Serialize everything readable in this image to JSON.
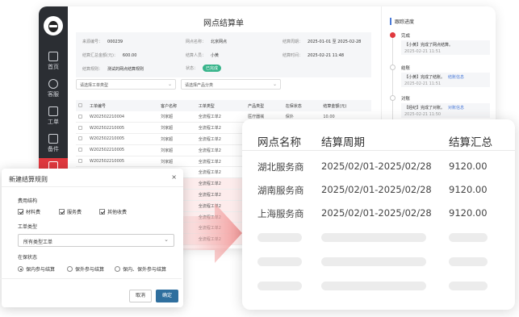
{
  "sidebar": {
    "items": [
      {
        "label": "首页"
      },
      {
        "label": "客服"
      },
      {
        "label": "工单"
      },
      {
        "label": "备件"
      },
      {
        "label": ""
      }
    ]
  },
  "page": {
    "title": "网点结算单",
    "info": {
      "order_no_label": "来源编号：",
      "order_no": "000239",
      "branch_label": "网点名称：",
      "branch": "北京网点",
      "period_label": "结算周期：",
      "period": "2025-01-01 至 2025-02-28",
      "amount_label": "结算汇总金额(元)：",
      "amount": "600.00",
      "creator_label": "结算人员：",
      "creator": "小黄",
      "time_label": "结算时间：",
      "time": "2025-02-21 11:48",
      "rule_label": "结算规则：",
      "rule": "测试的网点结算规则",
      "status_label": "状态：",
      "status": "已完成"
    },
    "filters": {
      "order_type_placeholder": "请选择工单类型",
      "product_placeholder": "请选择产品分类"
    },
    "table": {
      "headers": [
        "",
        "工单编号",
        "客户名称",
        "工单类型",
        "产品类型",
        "在保状态",
        "结算金额(元)"
      ],
      "rows": [
        [
          "W202502210004",
          "刘家超",
          "全流程工单2",
          "医疗器械",
          "保外",
          "10.00"
        ],
        [
          "W202502210005",
          "刘家超",
          "全流程工单2",
          "",
          "",
          ""
        ],
        [
          "W202502210005",
          "刘家超",
          "全流程工单2",
          "",
          "",
          ""
        ],
        [
          "W202502210005",
          "刘家超",
          "全流程工单2",
          "",
          "",
          ""
        ],
        [
          "W202502210005",
          "刘家超",
          "全流程工单2",
          "",
          "",
          ""
        ],
        [
          "W202502210004",
          "刘家超",
          "全流程工单2",
          "",
          "",
          ""
        ],
        [
          "",
          "",
          "全流程工单2",
          "",
          "",
          ""
        ],
        [
          "",
          "",
          "全流程工单2",
          "",
          "",
          ""
        ],
        [
          "",
          "",
          "全流程工单2",
          "",
          "",
          ""
        ],
        [
          "",
          "",
          "全流程工单2",
          "",
          "",
          ""
        ],
        [
          "",
          "",
          "全流程工单2",
          "",
          "",
          ""
        ],
        [
          "",
          "",
          "全流程工单2",
          "",
          "",
          ""
        ]
      ]
    }
  },
  "progress": {
    "title": "跟踪进度",
    "entries": [
      {
        "head": "完成",
        "text": "【小黄】完成了网点结算。",
        "time": "2025-02-21 11:51",
        "link": ""
      },
      {
        "head": "结账",
        "text": "【小黄】完成了结账。",
        "time": "2025-02-21 11:51",
        "link": "结账信息"
      },
      {
        "head": "对账",
        "text": "【经纪】完成了对账。",
        "time": "2025-02-21 11:50",
        "link": "对账信息"
      }
    ]
  },
  "summary": {
    "headers": [
      "网点名称",
      "结算周期",
      "结算汇总"
    ],
    "rows": [
      [
        "湖北服务商",
        "2025/02/01-2025/02/28",
        "9120.00"
      ],
      [
        "湖南服务商",
        "2025/02/01-2025/02/28",
        "9120.00"
      ],
      [
        "上海服务商",
        "2025/02/01-2025/02/28",
        "9120.00"
      ]
    ]
  },
  "dialog": {
    "title": "新建结算规则",
    "close": "×",
    "fee_label": "费用结构",
    "fee_options": [
      "材料费",
      "服务费",
      "其他收费"
    ],
    "type_label": "工单类型",
    "type_value": "所有类型工单",
    "warranty_label": "在保状态",
    "warranty_options": [
      "保内参与结算",
      "保外参与结算",
      "保内、保外参与结算"
    ],
    "cancel": "取消",
    "confirm": "确定"
  },
  "colors": {
    "accent_red": "#e0383e",
    "primary_blue": "#2f6f9e",
    "status_green": "#38b48b"
  }
}
